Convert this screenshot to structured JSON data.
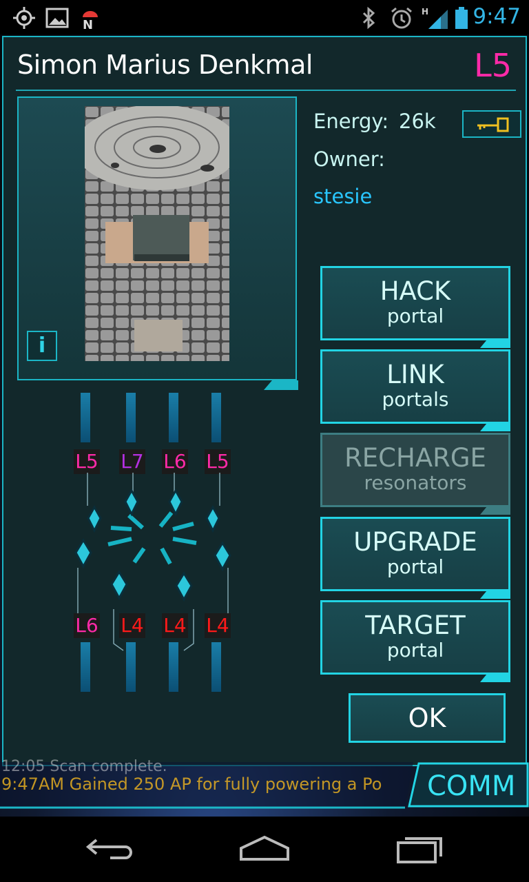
{
  "status_bar": {
    "time": "9:47",
    "icons": [
      "gps-icon",
      "image-notification-icon",
      "android-n-icon",
      "bluetooth-icon",
      "alarm-icon",
      "signal-h-icon",
      "battery-icon"
    ]
  },
  "portal": {
    "title": "Simon Marius Denkmal",
    "level": "L5",
    "energy_label": "Energy:",
    "energy_value": "26k",
    "owner_label": "Owner:",
    "owner_name": "stesie",
    "info_label": "i"
  },
  "resonators": {
    "top_levels": [
      "L5",
      "L7",
      "L6",
      "L5"
    ],
    "bottom_levels": [
      "L6",
      "L4",
      "L4",
      "L4"
    ]
  },
  "actions": [
    {
      "main": "HACK",
      "sub": "portal",
      "enabled": true
    },
    {
      "main": "LINK",
      "sub": "portals",
      "enabled": true
    },
    {
      "main": "RECHARGE",
      "sub": "resonators",
      "enabled": false
    },
    {
      "main": "UPGRADE",
      "sub": "portal",
      "enabled": true
    },
    {
      "main": "TARGET",
      "sub": "portal",
      "enabled": true
    }
  ],
  "ok_label": "OK",
  "comm": {
    "label": "COMM",
    "ticker_line1": "12:05 Scan complete.",
    "ticker_line2": "9:47AM Gained 250 AP for fully powering a Po"
  },
  "colors": {
    "accent": "#1bb6c6",
    "owner": "#29c6ff",
    "level_pink": "#ff2aa8",
    "level_l7": "#b430e0",
    "level_l4": "#ff1a1a",
    "clock": "#33b5e5"
  }
}
